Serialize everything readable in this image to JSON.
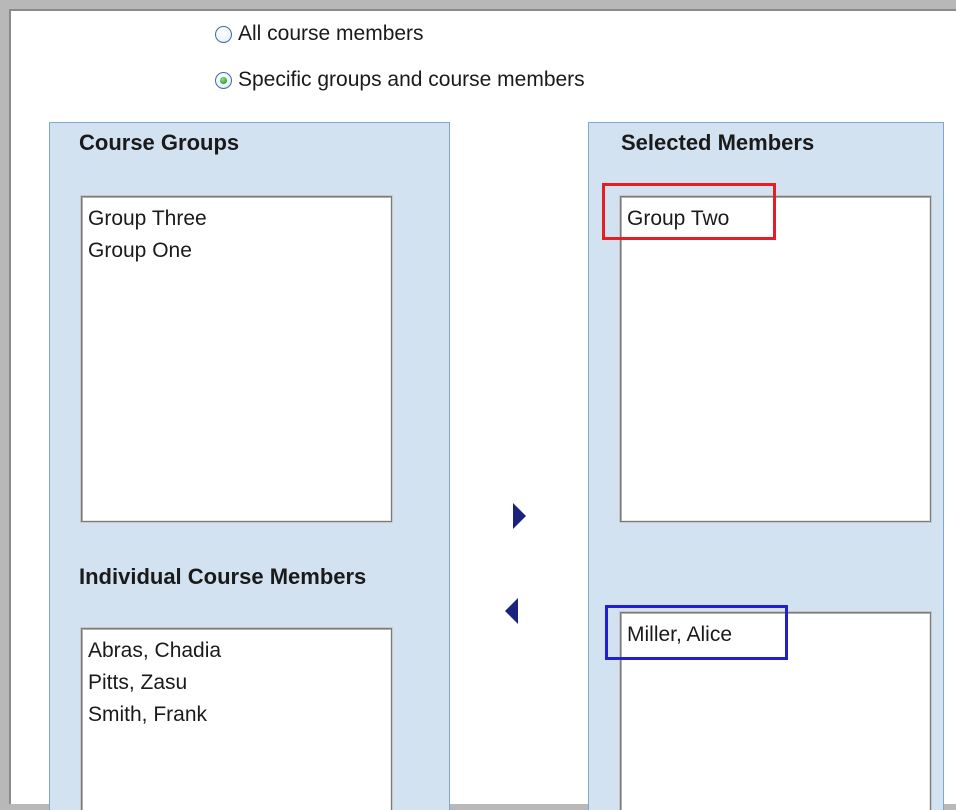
{
  "visibility": {
    "options": [
      {
        "label": "All course members",
        "selected": false
      },
      {
        "label": "Specific groups and course members",
        "selected": true
      }
    ]
  },
  "available": {
    "groups_heading": "Course Groups",
    "groups": [
      "Group Three",
      "Group One"
    ],
    "members_heading": "Individual Course Members",
    "members": [
      "Abras, Chadia",
      "Pitts, Zasu",
      "Smith, Frank"
    ]
  },
  "selected": {
    "heading": "Selected Members",
    "groups": [
      "Group Two"
    ],
    "members": [
      "Miller, Alice"
    ]
  },
  "controls": {
    "add_icon": "triangle-right-icon",
    "remove_icon": "triangle-left-icon"
  },
  "colors": {
    "panel_bg": "#d3e2f1",
    "panel_border": "#7fa7cf",
    "arrow": "#1a237e",
    "highlight_group": "#e41e26",
    "highlight_member": "#1f1fd6"
  }
}
